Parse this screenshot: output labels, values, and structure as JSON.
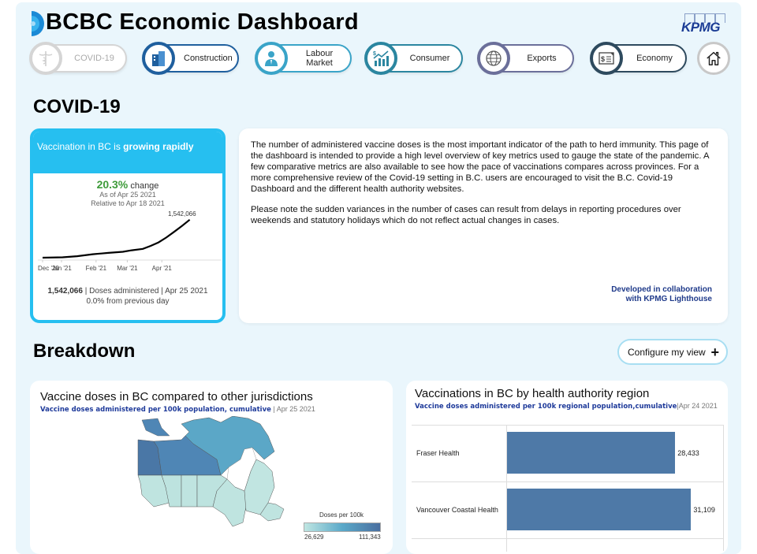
{
  "header": {
    "title": "BCBC Economic Dashboard",
    "brand": "KPMG"
  },
  "nav": [
    {
      "label": "COVID-19",
      "icon": "caduceus-icon",
      "color": "#d5d5d5",
      "active": true
    },
    {
      "label": "Construction",
      "icon": "building-icon",
      "color": "#1f5f9e"
    },
    {
      "label": "Labour Market",
      "icon": "worker-icon",
      "color": "#3aa4c8"
    },
    {
      "label": "Consumer",
      "icon": "growth-chart-icon",
      "color": "#2b86a0"
    },
    {
      "label": "Exports",
      "icon": "globe-icon",
      "color": "#6b6f9a"
    },
    {
      "label": "Economy",
      "icon": "finance-document-icon",
      "color": "#2e4a5e"
    }
  ],
  "home_label": "Home",
  "covid": {
    "section_title": "COVID-19",
    "card": {
      "headline_prefix": "Vaccination in BC is ",
      "headline_bold": "growing rapidly",
      "change_pct": "20.3%",
      "change_word": "change",
      "as_of": "As of Apr 25 2021",
      "relative_to": "Relative to Apr 18 2021",
      "doses_value": "1,542,066",
      "doses_caption": "| Doses administered | Apr 25 2021",
      "daily_change": "0.0% from previous day"
    },
    "chart_data": {
      "type": "line",
      "title": "",
      "xlabel": "",
      "ylabel": "",
      "x_ticks": [
        "Dec '20",
        "Jan '21",
        "Feb '21",
        "Mar '21",
        "Apr '21"
      ],
      "series": [
        {
          "name": "Doses administered (cumulative)",
          "x_days_since_dec14": [
            0,
            18,
            31,
            45,
            59,
            72,
            80,
            90,
            97,
            104,
            111,
            118,
            125,
            132
          ],
          "values": [
            0,
            15000,
            60000,
            140000,
            195000,
            240000,
            300000,
            360000,
            480000,
            620000,
            820000,
            1050000,
            1290000,
            1542066
          ]
        }
      ],
      "end_label": "1,542,066",
      "ylim": [
        0,
        1600000
      ]
    },
    "description": [
      "The number of administered vaccine doses is the most important indicator of the path to herd immunity. This page of the dashboard is intended to provide a high level overview of key metrics used to gauge the state of the pandemic. A few comparative metrics are also available to see how the pace of vaccinations compares across provinces. For a more comprehensive review of the Covid-19 setting in B.C. users are encouraged to visit the B.C. Covid-19 Dashboard and the different health authority websites.",
      "Please note the sudden variances in the number of cases can result from delays in reporting procedures over weekends and statutory holidays which do not reflect actual changes in cases."
    ],
    "collab_line1": "Developed in collaboration",
    "collab_line2": "with KPMG Lighthouse"
  },
  "breakdown": {
    "section_title": "Breakdown",
    "configure_label": "Configure my view",
    "map_card": {
      "title": "Vaccine doses in BC compared to other jurisdictions",
      "subtitle_bold": "Vaccine doses administered per 100k population, cumulative",
      "subtitle_date": " | Apr 25 2021",
      "legend_title": "Doses per 100k",
      "legend_min": "26,629",
      "legend_max": "111,343"
    },
    "region_card": {
      "title": "Vaccinations in BC by health authority region",
      "subtitle_bold": "Vaccine doses administered per 100k regional population,cumulative",
      "subtitle_date": "|Apr 24 2021"
    },
    "chart_data": {
      "type": "bar",
      "title": "Vaccinations in BC by health authority region",
      "categories": [
        "Fraser Health",
        "Vancouver Coastal Health"
      ],
      "values": [
        28433,
        31109
      ],
      "value_labels": [
        "28,433",
        "31,109"
      ],
      "xlim": [
        0,
        36000
      ],
      "color": "#4e79a7"
    }
  }
}
